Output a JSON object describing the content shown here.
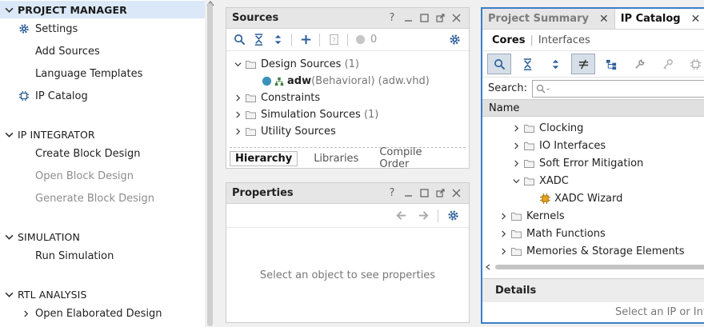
{
  "flow_navigator": {
    "project_manager": {
      "title": "PROJECT MANAGER",
      "items": [
        {
          "label": "Settings",
          "icon": "gear-icon"
        },
        {
          "label": "Add Sources"
        },
        {
          "label": "Language Templates"
        },
        {
          "label": "IP Catalog",
          "icon": "ip-chip-icon"
        }
      ]
    },
    "ip_integrator": {
      "title": "IP INTEGRATOR",
      "items": [
        {
          "label": "Create Block Design",
          "enabled": true
        },
        {
          "label": "Open Block Design",
          "enabled": false
        },
        {
          "label": "Generate Block Design",
          "enabled": false
        }
      ]
    },
    "simulation": {
      "title": "SIMULATION",
      "items": [
        {
          "label": "Run Simulation"
        }
      ]
    },
    "rtl_analysis": {
      "title": "RTL ANALYSIS",
      "items": [
        {
          "label": "Open Elaborated Design"
        }
      ]
    }
  },
  "sources": {
    "title": "Sources",
    "controls": {
      "help": "?"
    },
    "badge_count": "0",
    "tree": {
      "design_sources": {
        "label": "Design Sources",
        "count": "(1)"
      },
      "adw": {
        "name": "adw",
        "detail": "(Behavioral) (adw.vhd)"
      },
      "constraints": {
        "label": "Constraints"
      },
      "simulation_sources": {
        "label": "Simulation Sources",
        "count": "(1)"
      },
      "utility_sources": {
        "label": "Utility Sources"
      }
    },
    "tabs": [
      "Hierarchy",
      "Libraries",
      "Compile Order"
    ]
  },
  "properties": {
    "title": "Properties",
    "controls": {
      "help": "?"
    },
    "empty_message": "Select an object to see properties"
  },
  "ip_catalog_pane": {
    "doc_tabs": [
      {
        "label": "Project Summary",
        "close": "✕"
      },
      {
        "label": "IP Catalog",
        "close": "✕"
      }
    ],
    "sub_tabs": {
      "cores": "Cores",
      "separator": "|",
      "interfaces": "Interfaces"
    },
    "search": {
      "label": "Search:",
      "placeholder": "Q-"
    },
    "column_name": "Name",
    "tree": {
      "clocking": "Clocking",
      "io_interfaces": "IO Interfaces",
      "soft_error": "Soft Error Mitigation",
      "xadc": "XADC",
      "xadc_wizard": "XADC Wizard",
      "kernels": "Kernels",
      "math_functions": "Math Functions",
      "memories": "Memories & Storage Elements"
    },
    "details": {
      "title": "Details",
      "message": "Select an IP or Int"
    }
  },
  "colors": {
    "accent": "#3e7ec8",
    "selected_header": "#dbe8f8",
    "gear": "#2c5f9a"
  }
}
